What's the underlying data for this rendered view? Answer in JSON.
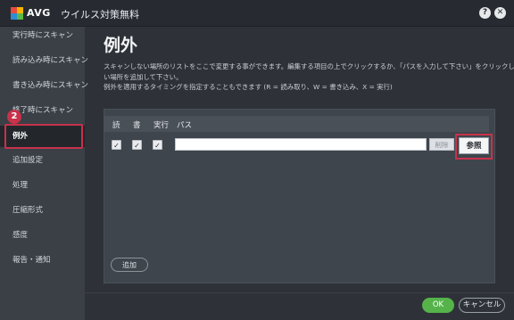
{
  "window": {
    "brand": "AVG",
    "title": "ウイルス対策無料",
    "help_icon": "?",
    "close_icon": "✕"
  },
  "sidebar": {
    "items": [
      {
        "label": "実行時にスキャン"
      },
      {
        "label": "読み込み時にスキャン"
      },
      {
        "label": "書き込み時にスキャン"
      },
      {
        "label": "終了時にスキャン"
      },
      {
        "label": "例外"
      },
      {
        "label": "追加設定"
      },
      {
        "label": "処理"
      },
      {
        "label": "圧縮形式"
      },
      {
        "label": "感度"
      },
      {
        "label": "報告・通知"
      }
    ],
    "active_index": 4,
    "step_badge": "2"
  },
  "main": {
    "title": "例外",
    "description_lines": [
      "スキャンしない場所のリストをここで変更する事ができます。編集する項目の上でクリックするか、「パスを入力して下さい」をクリックして新し",
      "い場所を追加して下さい。",
      "例外を適用するタイミングを指定することもできます (R = 読み取り、W = 書き込み、X = 実行)"
    ],
    "table": {
      "headers": [
        "読",
        "書",
        "実行",
        "パス"
      ],
      "row": {
        "read": true,
        "write": true,
        "execute": true,
        "path": ""
      },
      "check_glyph": "✓",
      "delete_label": "削除",
      "browse_label": "参照"
    },
    "add_label": "追加"
  },
  "footer": {
    "ok_label": "OK",
    "cancel_label": "キャンセル"
  },
  "colors": {
    "accent_red": "#c8324a",
    "ok_green": "#55b34a",
    "background": "#2e3238",
    "sidebar": "#3b4047"
  }
}
